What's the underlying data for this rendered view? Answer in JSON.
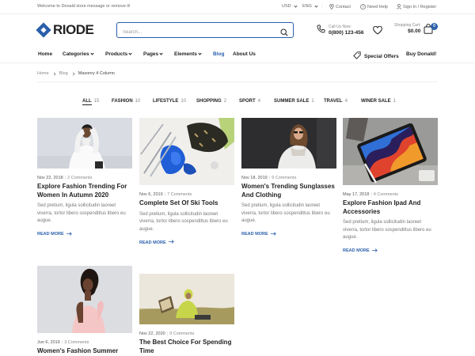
{
  "topbar": {
    "welcome": "Welcome to Donald store message or remove it!",
    "currency": "USD",
    "language": "ENG",
    "contact": "Contact",
    "help": "Need Help",
    "signin": "Sign In / Register"
  },
  "header": {
    "logo": "RIODE",
    "search_placeholder": "Search...",
    "call_label": "Call Us Now:",
    "call_number": "0(800) 123-456",
    "cart_label": "Shopping Cart:",
    "cart_total": "$0.00",
    "cart_count": "0"
  },
  "nav": {
    "items": [
      "Home",
      "Categories",
      "Products",
      "Pages",
      "Elements",
      "Blog",
      "About Us"
    ],
    "special": "Special Offers",
    "buy": "Buy Donald!"
  },
  "breadcrumb": [
    "Home",
    "Blog",
    "Masonry 4 Column"
  ],
  "filters": [
    {
      "label": "ALL",
      "count": "15"
    },
    {
      "label": "FASHION",
      "count": "10"
    },
    {
      "label": "LIFESTYLE",
      "count": "10"
    },
    {
      "label": "SHOPPING",
      "count": "2"
    },
    {
      "label": "SPORT",
      "count": "4"
    },
    {
      "label": "SUMMER SALE",
      "count": "1"
    },
    {
      "label": "TRAVEL",
      "count": "4"
    },
    {
      "label": "WINER SALE",
      "count": "1"
    }
  ],
  "posts": [
    {
      "date": "Nov 22, 2018",
      "comments": "2 Comments",
      "title": "Explore Fashion Trending For Women In Autumn 2020",
      "excerpt": "Sed pretium, ligula sollicitudin laoreet viverra, tortor libero sospendittus libero eu augue.",
      "more": "READ MORE"
    },
    {
      "date": "Nov 6, 2019",
      "comments": "7 Comments",
      "title": "Complete Set Of Ski Tools",
      "excerpt": "Sed pretium, ligula sollicitudin laoreet viverra, tortor libero sospendittus libero eu augue.",
      "more": "READ MORE"
    },
    {
      "date": "Nov 18, 2019",
      "comments": "9 Comments",
      "title": "Women's Trending Sunglasses And Clothing",
      "excerpt": "Sed pretium, ligula sollicitudin laoreet viverra, tortor libero sospendittus libero eu augue.",
      "more": "READ MORE"
    },
    {
      "date": "May 17, 2018",
      "comments": "4 Comments",
      "title": "Explore Fashion Ipad And Accessories",
      "excerpt": "Sed pretium, ligula sollicitudin laoreet viverra, tortor libero sospendittus libero eu augue.",
      "more": "READ MORE"
    },
    {
      "date": "Jun 6, 2019",
      "comments": "3 Comments",
      "title": "Women's Fashion Summer",
      "excerpt": "",
      "more": ""
    },
    {
      "date": "Nov 22, 2020",
      "comments": "9 Comments",
      "title": "The Best Choice For Spending Time",
      "excerpt": "",
      "more": ""
    }
  ],
  "colors": {
    "accent": "#2a5fab",
    "text": "#222222",
    "muted": "#888888"
  }
}
